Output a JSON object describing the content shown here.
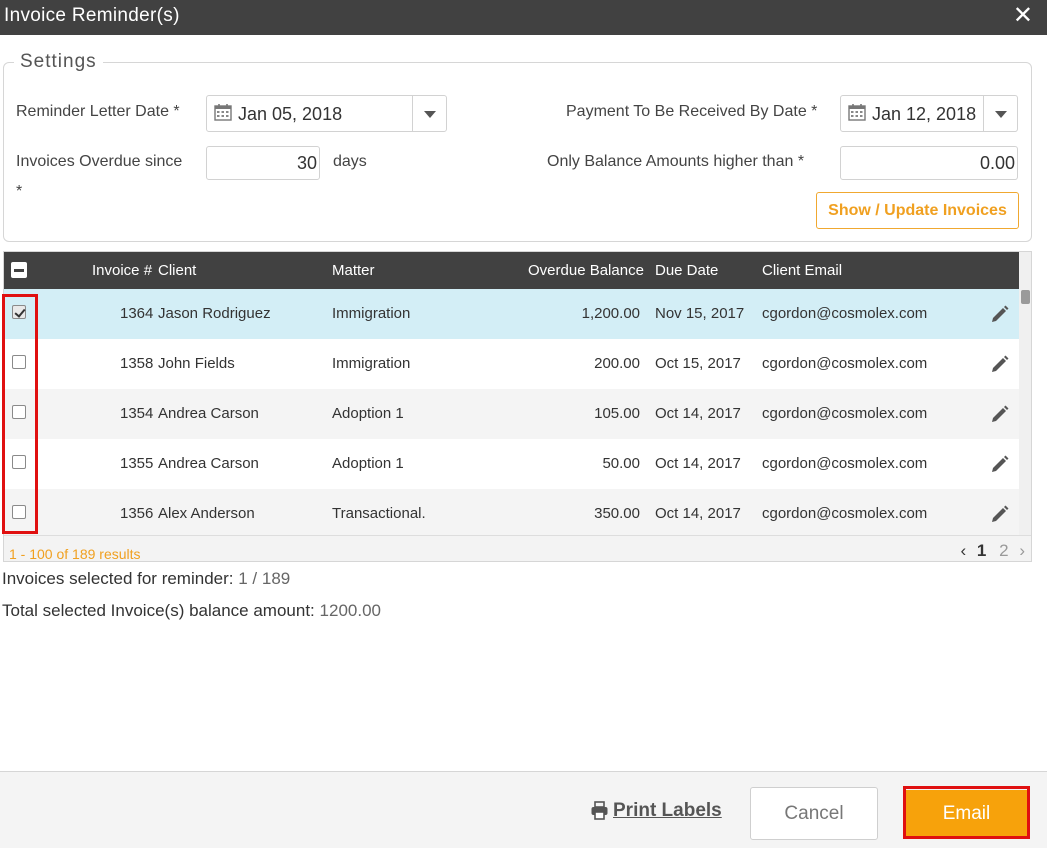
{
  "dialog": {
    "title": "Invoice Reminder(s)",
    "close_glyph": "✕"
  },
  "settings": {
    "legend": "Settings",
    "reminder_date_label": "Reminder Letter Date *",
    "reminder_date_value": "Jan 05, 2018",
    "payment_date_label": "Payment To Be Received By Date *",
    "payment_date_value": "Jan 12, 2018",
    "overdue_label_line1": "Invoices Overdue since",
    "overdue_label_line2": "*",
    "overdue_value": "30",
    "overdue_unit": "days",
    "balance_label": "Only Balance Amounts higher than *",
    "balance_value": "0.00",
    "show_update_button": "Show / Update Invoices"
  },
  "grid": {
    "columns": [
      "Invoice #",
      "Client",
      "Matter",
      "Overdue Balance",
      "Due Date",
      "Client Email"
    ],
    "rows": [
      {
        "selected": true,
        "invoice": "1364",
        "client": "Jason Rodriguez",
        "matter": "Immigration",
        "balance": "1,200.00",
        "due": "Nov 15, 2017",
        "email": "cgordon@cosmolex.com"
      },
      {
        "selected": false,
        "invoice": "1358",
        "client": "John Fields",
        "matter": "Immigration",
        "balance": "200.00",
        "due": "Oct 15, 2017",
        "email": "cgordon@cosmolex.com"
      },
      {
        "selected": false,
        "invoice": "1354",
        "client": "Andrea Carson",
        "matter": "Adoption 1",
        "balance": "105.00",
        "due": "Oct 14, 2017",
        "email": "cgordon@cosmolex.com"
      },
      {
        "selected": false,
        "invoice": "1355",
        "client": "Andrea Carson",
        "matter": "Adoption 1",
        "balance": "50.00",
        "due": "Oct 14, 2017",
        "email": "cgordon@cosmolex.com"
      },
      {
        "selected": false,
        "invoice": "1356",
        "client": "Alex Anderson",
        "matter": "Transactional.",
        "balance": "350.00",
        "due": "Oct 14, 2017",
        "email": "cgordon@cosmolex.com"
      }
    ],
    "results_text": "1 - 100 of 189 results",
    "pager": {
      "prev": "‹",
      "current": "1",
      "next_page": "2",
      "next": "›"
    }
  },
  "summary": {
    "selected_label": "Invoices selected for reminder:",
    "selected_value": "1 / 189",
    "total_label": "Total selected Invoice(s) balance amount:",
    "total_value": "1200.00"
  },
  "footer": {
    "print_labels": "Print Labels",
    "cancel": "Cancel",
    "email": "Email"
  },
  "colors": {
    "accent": "#f7a20b",
    "header_bg": "#414141",
    "selected_row": "#d3eef6",
    "highlight": "#e01010"
  }
}
